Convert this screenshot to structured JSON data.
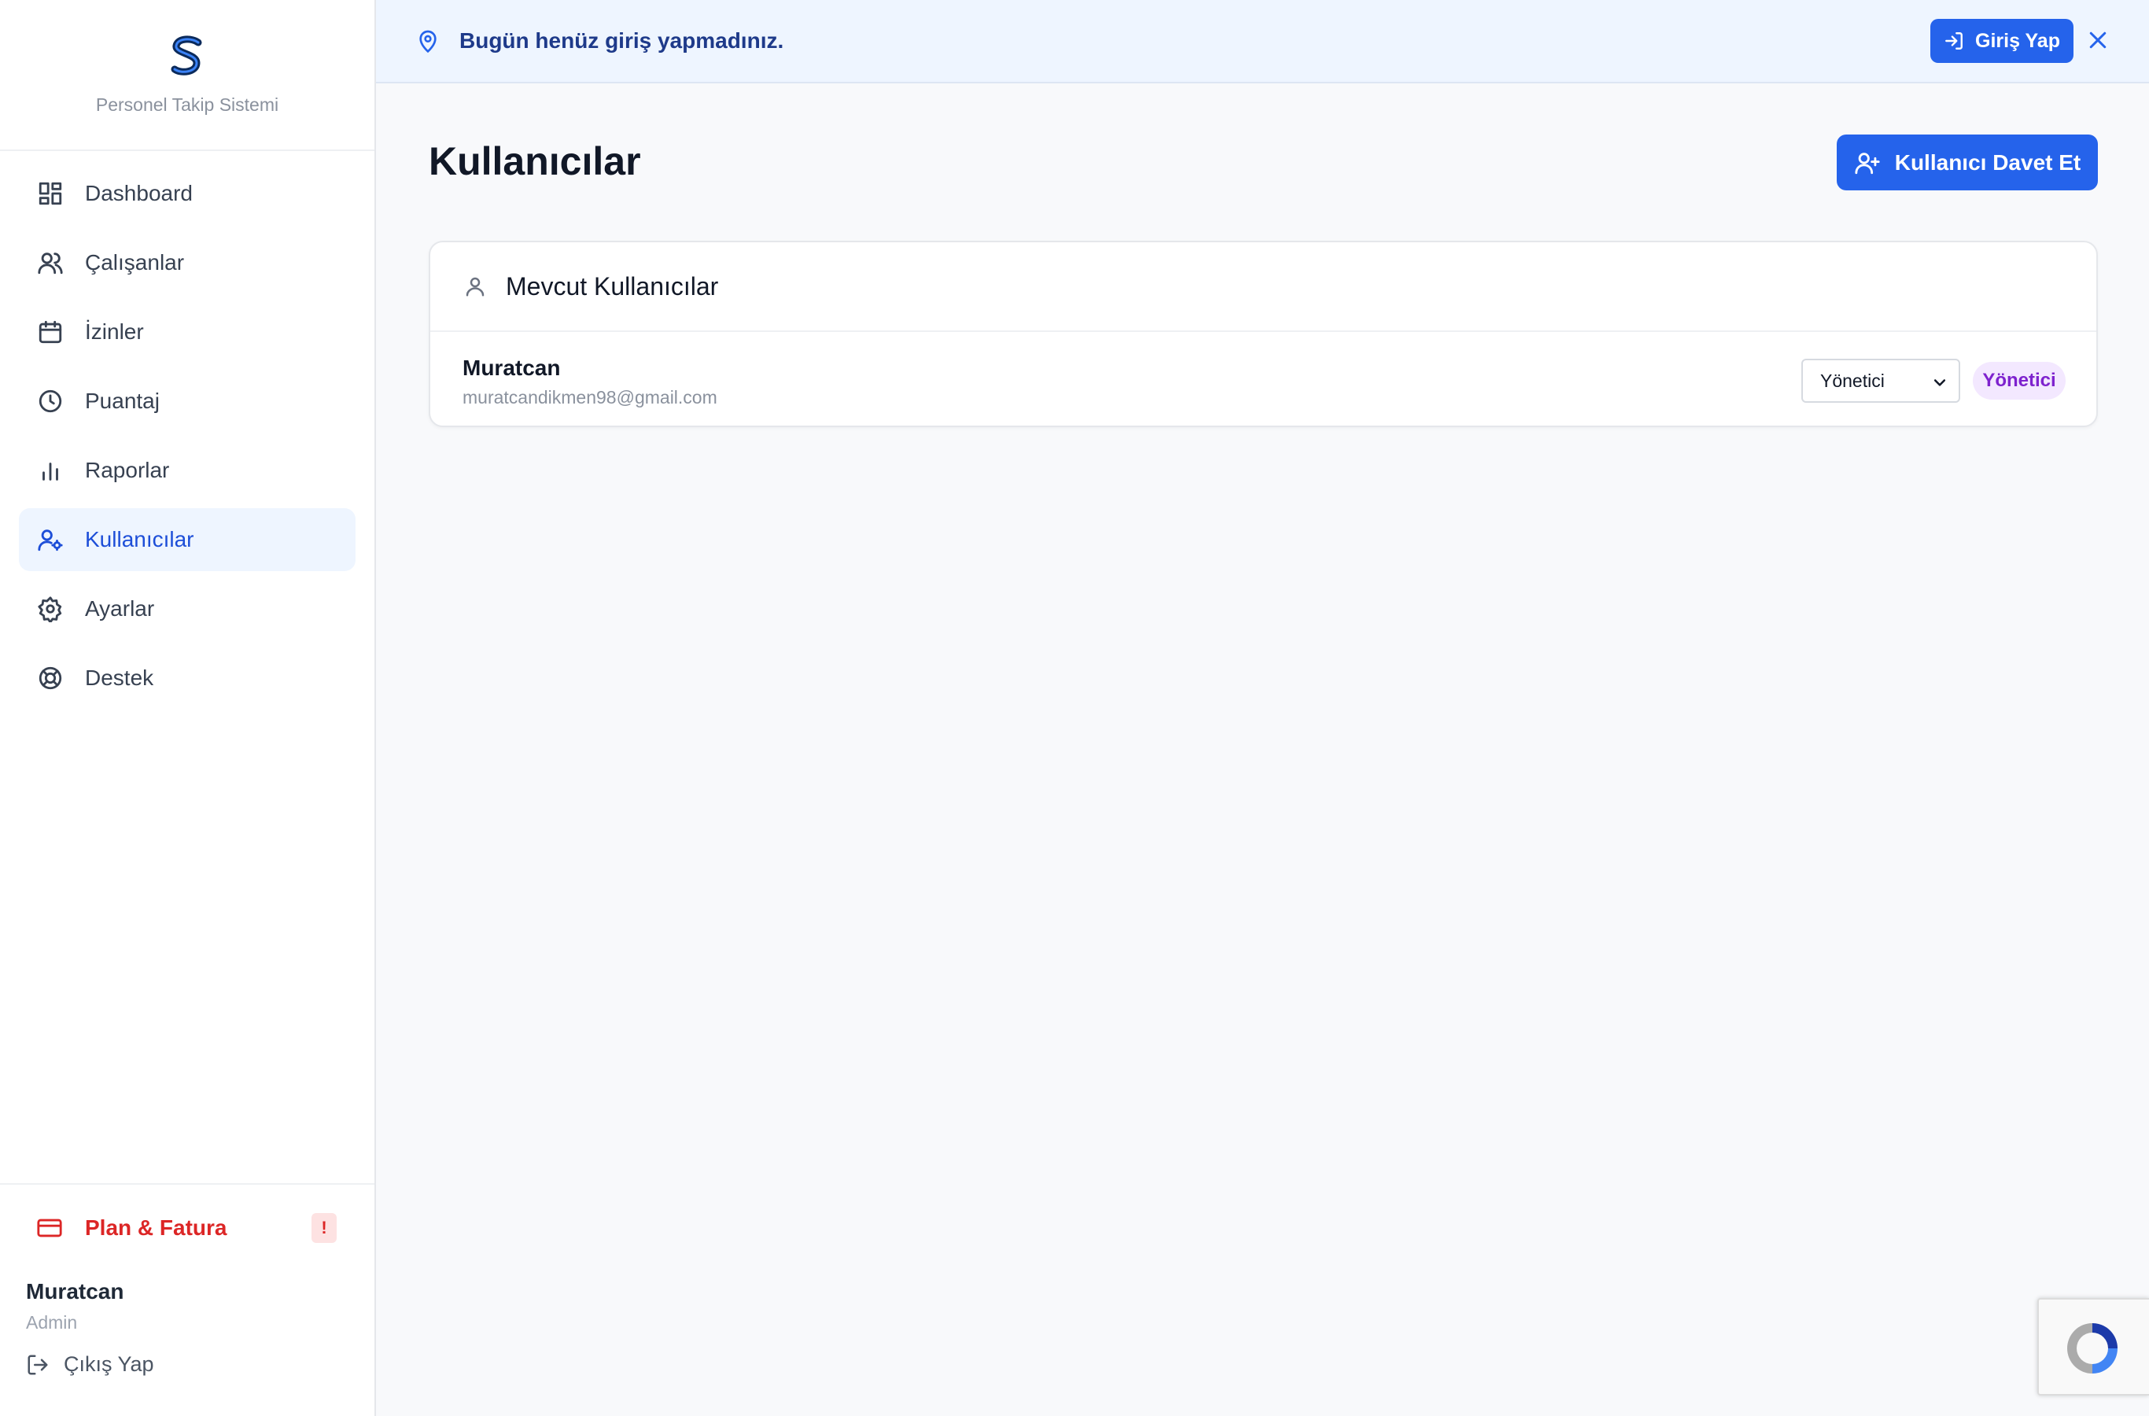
{
  "brand": {
    "subtitle": "Personel Takip Sistemi"
  },
  "sidebar": {
    "items": [
      {
        "label": "Dashboard",
        "icon": "dashboard-icon"
      },
      {
        "label": "Çalışanlar",
        "icon": "users-icon"
      },
      {
        "label": "İzinler",
        "icon": "calendar-icon"
      },
      {
        "label": "Puantaj",
        "icon": "clock-icon"
      },
      {
        "label": "Raporlar",
        "icon": "bar-chart-icon"
      },
      {
        "label": "Kullanıcılar",
        "icon": "user-cog-icon",
        "active": true
      },
      {
        "label": "Ayarlar",
        "icon": "gear-icon"
      },
      {
        "label": "Destek",
        "icon": "lifebuoy-icon"
      }
    ],
    "plan_label": "Plan & Fatura",
    "plan_badge": "!",
    "user_name": "Muratcan",
    "user_role": "Admin",
    "logout_label": "Çıkış Yap"
  },
  "banner": {
    "text": "Bugün henüz giriş yapmadınız.",
    "login_label": "Giriş Yap"
  },
  "main": {
    "title": "Kullanıcılar",
    "invite_label": "Kullanıcı Davet Et",
    "card_title": "Mevcut Kullanıcılar",
    "users": [
      {
        "name": "Muratcan",
        "email": "muratcandikmen98@gmail.com",
        "role_select": "Yönetici",
        "role_badge": "Yönetici"
      }
    ]
  },
  "colors": {
    "primary": "#2563eb",
    "danger": "#dc2626",
    "badge_purple": "#7e22ce",
    "active_bg": "#eef5ff"
  }
}
